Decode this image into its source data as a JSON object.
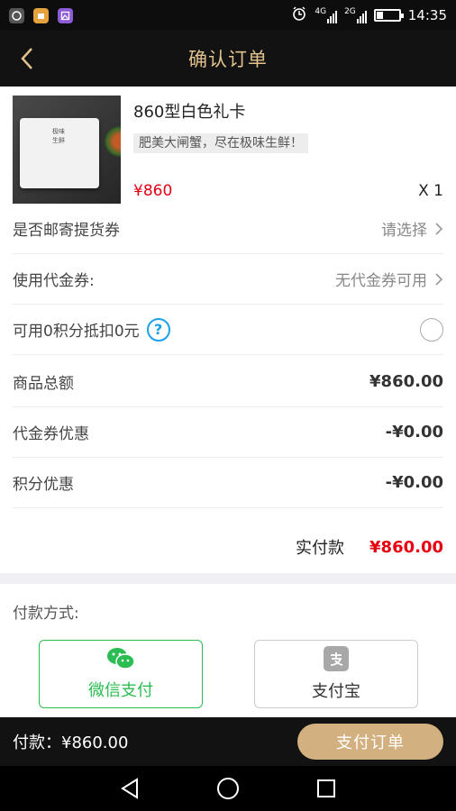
{
  "status_bar": {
    "time": "14:35",
    "network_1": "4G",
    "network_2": "2G"
  },
  "header": {
    "title": "确认订单"
  },
  "product": {
    "name": "860型白色礼卡",
    "slogan": "肥美大闸蟹，尽在极味生鲜！",
    "price": "¥860",
    "quantity": "X 1",
    "card_logo_text": "极味生鲜"
  },
  "rows": {
    "mail_voucher": {
      "label": "是否邮寄提货券",
      "value": "请选择"
    },
    "coupon": {
      "label": "使用代金券:",
      "value": "无代金券可用"
    },
    "points": {
      "label": "可用0积分抵扣0元",
      "help": "?"
    },
    "goods_total": {
      "label": "商品总额",
      "value": "¥860.00"
    },
    "coupon_discount": {
      "label": "代金券优惠",
      "value": "-¥0.00"
    },
    "points_discount": {
      "label": "积分优惠",
      "value": "-¥0.00"
    }
  },
  "amount_due": {
    "label": "实付款",
    "value": "¥860.00"
  },
  "payment": {
    "title": "付款方式:",
    "options": [
      {
        "label": "微信支付",
        "selected": true
      },
      {
        "label": "支付宝",
        "selected": false
      }
    ]
  },
  "bottom_bar": {
    "total": "付款：¥860.00",
    "submit_label": "支付订单"
  },
  "colors": {
    "accent_gold": "#e1c28d",
    "button_gold": "#d3b080",
    "price_red": "#e60012",
    "wechat_green": "#2bbd52",
    "help_blue": "#1aa1e8"
  }
}
